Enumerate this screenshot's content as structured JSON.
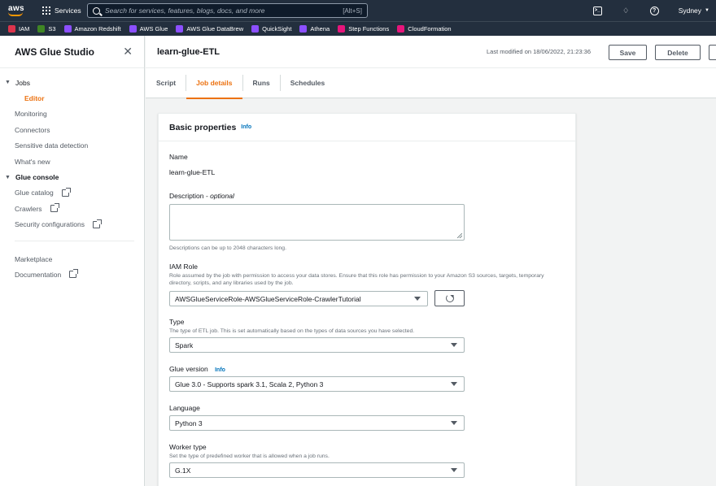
{
  "topnav": {
    "logo_text": "aws",
    "services_label": "Services",
    "search_placeholder": "Search for services, features, blogs, docs, and more",
    "search_shortcut": "[Alt+S]",
    "region": "Sydney"
  },
  "favorites": [
    {
      "label": "IAM",
      "color": "#dd344c"
    },
    {
      "label": "S3",
      "color": "#3f8624"
    },
    {
      "label": "Amazon Redshift",
      "color": "#8c4fff"
    },
    {
      "label": "AWS Glue",
      "color": "#8c4fff"
    },
    {
      "label": "AWS Glue DataBrew",
      "color": "#8c4fff"
    },
    {
      "label": "QuickSight",
      "color": "#8c4fff"
    },
    {
      "label": "Athena",
      "color": "#8c4fff"
    },
    {
      "label": "Step Functions",
      "color": "#e7157b"
    },
    {
      "label": "CloudFormation",
      "color": "#e7157b"
    }
  ],
  "sidebar": {
    "title": "AWS Glue Studio",
    "jobs": "Jobs",
    "editor": "Editor",
    "monitoring": "Monitoring",
    "connectors": "Connectors",
    "sensitive": "Sensitive data detection",
    "whats_new": "What's new",
    "glue_console": "Glue console",
    "glue_catalog": "Glue catalog",
    "crawlers": "Crawlers",
    "security_configs": "Security configurations",
    "marketplace": "Marketplace",
    "documentation": "Documentation"
  },
  "header": {
    "job_name": "learn-glue-ETL",
    "last_modified": "Last modified on 18/06/2022, 21:23:36",
    "save_label": "Save",
    "delete_label": "Delete"
  },
  "tabs": [
    "Script",
    "Job details",
    "Runs",
    "Schedules"
  ],
  "active_tab": "Job details",
  "basic": {
    "title": "Basic properties",
    "info": "Info",
    "name_label": "Name",
    "name_value": "learn-glue-ETL",
    "description_label": "Description",
    "description_optional": "- optional",
    "description_value": "",
    "description_hint": "Descriptions can be up to 2048 characters long.",
    "iam_label": "IAM Role",
    "iam_desc": "Role assumed by the job with permission to access your data stores. Ensure that this role has permission to your Amazon S3 sources, targets, temporary directory, scripts, and any libraries used by the job.",
    "iam_value": "AWSGlueServiceRole-AWSGlueServiceRole-CrawlerTutorial",
    "type_label": "Type",
    "type_desc": "The type of ETL job. This is set automatically based on the types of data sources you have selected.",
    "type_value": "Spark",
    "glue_version_label": "Glue version",
    "glue_version_info": "Info",
    "glue_version_value": "Glue 3.0 - Supports spark 3.1, Scala 2, Python 3",
    "language_label": "Language",
    "language_value": "Python 3",
    "worker_type_label": "Worker type",
    "worker_type_desc": "Set the type of predefined worker that is allowed when a job runs.",
    "worker_type_value": "G.1X"
  }
}
